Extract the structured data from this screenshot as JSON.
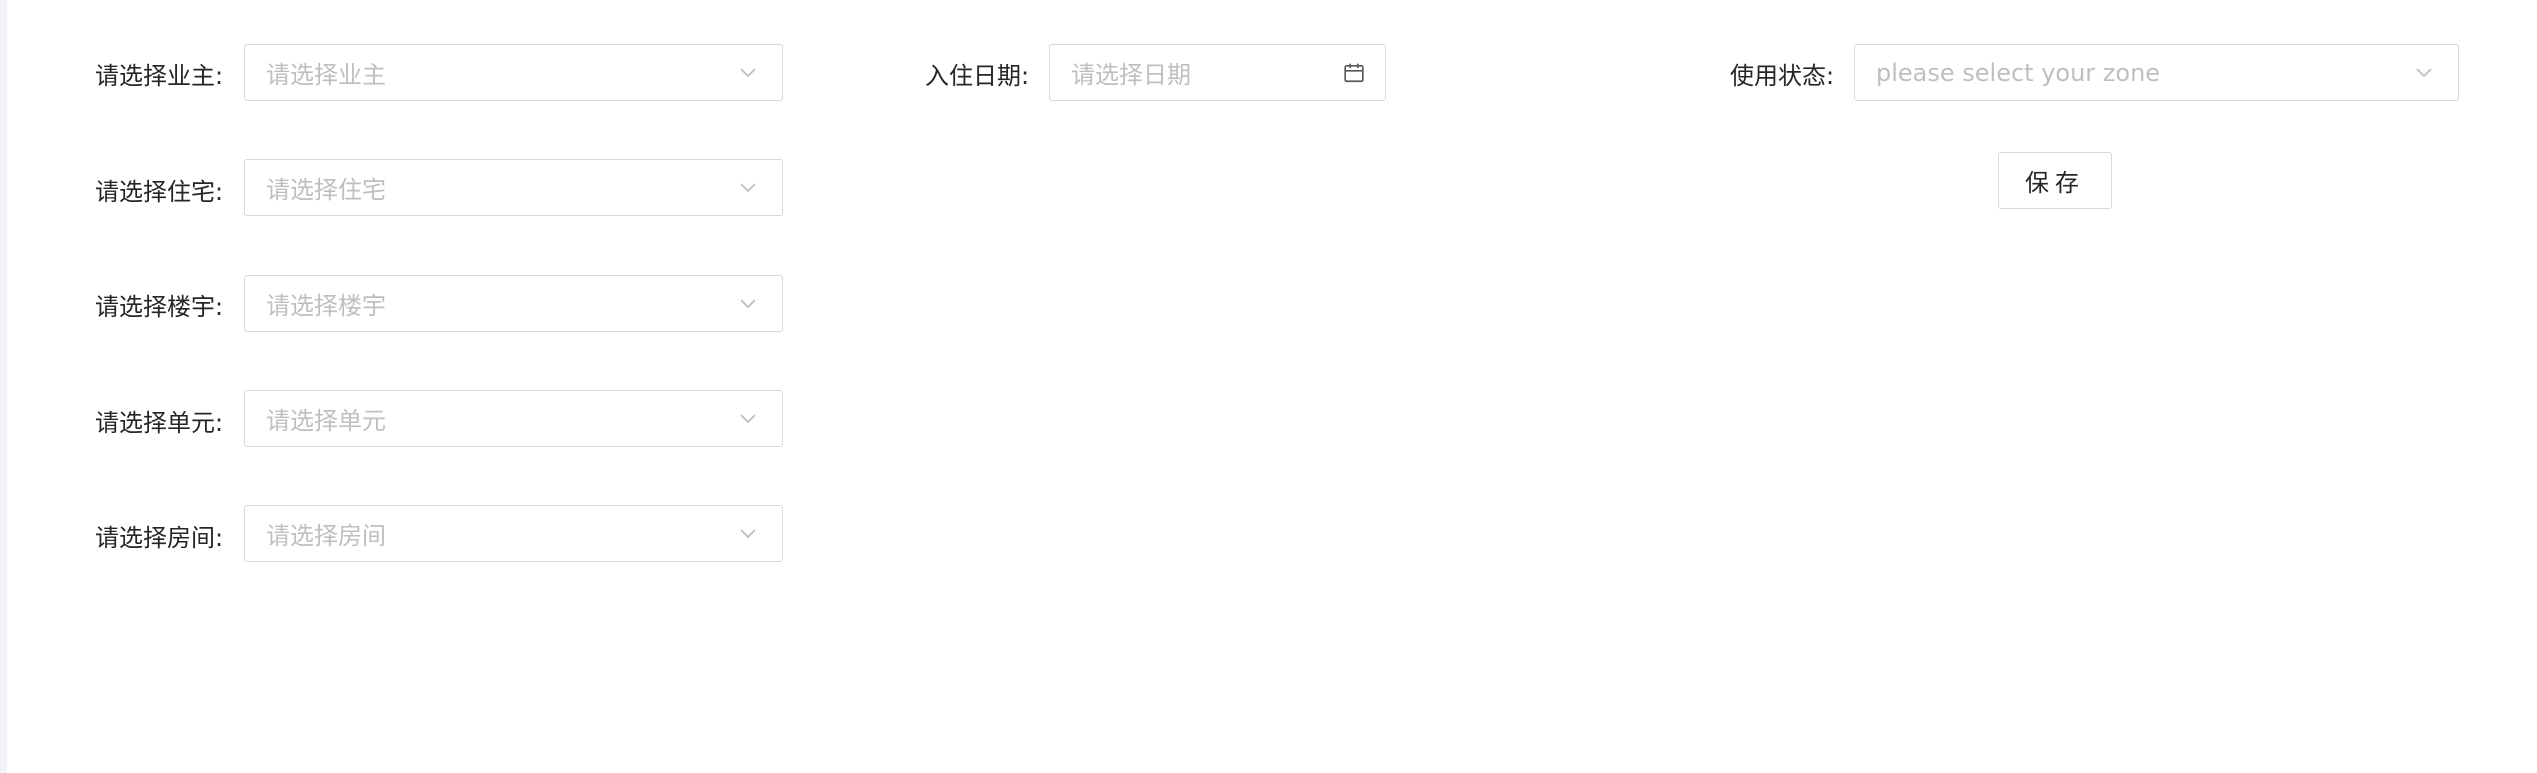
{
  "form": {
    "owner": {
      "label": "请选择业主:",
      "placeholder": "请选择业主"
    },
    "residence": {
      "label": "请选择住宅:",
      "placeholder": "请选择住宅"
    },
    "building": {
      "label": "请选择楼宇:",
      "placeholder": "请选择楼宇"
    },
    "unit": {
      "label": "请选择单元:",
      "placeholder": "请选择单元"
    },
    "room": {
      "label": "请选择房间:",
      "placeholder": "请选择房间"
    },
    "checkin_date": {
      "label": "入住日期:",
      "placeholder": "请选择日期"
    },
    "usage_status": {
      "label": "使用状态:",
      "placeholder": "please select your zone"
    }
  },
  "actions": {
    "save_label": "保存"
  },
  "icons": {
    "select_arrow": "chevron-down-icon",
    "date": "calendar-icon"
  },
  "colors": {
    "border": "#d9d9d9",
    "placeholder": "#bfbfbf",
    "label": "#262626",
    "rail": "#f0f2f5"
  }
}
